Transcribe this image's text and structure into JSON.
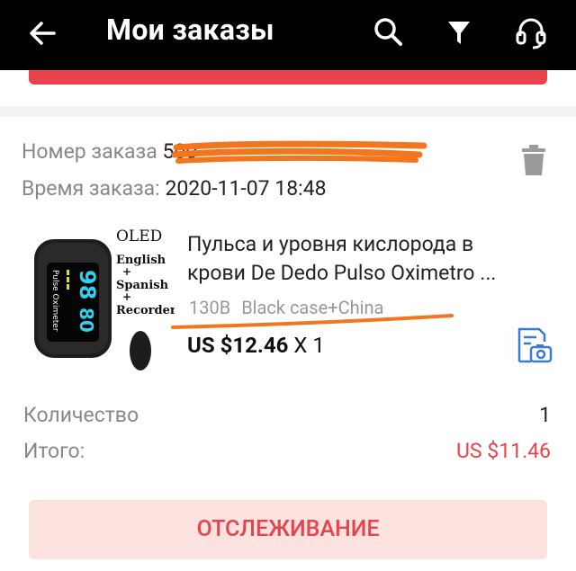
{
  "header": {
    "title": "Мои заказы"
  },
  "order": {
    "number_label": "Номер заказа",
    "number_value": "500",
    "time_label": "Время заказа:",
    "time_value": "2020-11-07 18:48",
    "product": {
      "title_line1": "Пульса и уровня кислорода в",
      "title_line2": "крови De Dedo Pulso Oximetro ...",
      "sku_model": "130B",
      "sku_variant": "Black case+China",
      "price": "US $12.46",
      "quantity_text": "X 1",
      "image": {
        "brand_text": "OLED",
        "features": [
          "English",
          "+",
          "Spanish",
          "+",
          "Recorder"
        ],
        "device_label": "Pulse Oximeter",
        "screen_reading_1": "98",
        "screen_reading_2": "80"
      }
    },
    "summary": {
      "quantity_label": "Количество",
      "quantity_value": "1",
      "total_label": "Итого:",
      "total_value": "US $11.46"
    },
    "track_button_label": "ОТСЛЕЖИВАНИЕ"
  },
  "colors": {
    "accent": "#e8434c",
    "button_bg": "#fde3e0",
    "annotation": "#f2761e",
    "screen_text": "#2fd0f0"
  }
}
